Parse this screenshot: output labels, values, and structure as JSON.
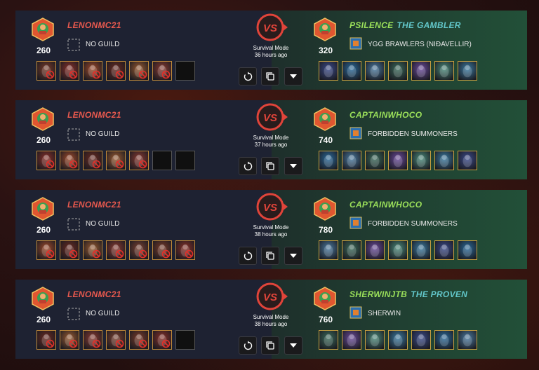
{
  "battles": [
    {
      "vs_label": "VS",
      "mode": "Survival Mode",
      "time": "36 hours ago",
      "left": {
        "name": "LENONMC21",
        "title": "",
        "rating": "260",
        "guild": "NO GUILD",
        "cards": [
          "c1",
          "c2",
          "c3",
          "c4",
          "c5",
          "c6",
          "empty"
        ]
      },
      "right": {
        "name": "PSILENCE",
        "title": "THE GAMBLER",
        "rating": "320",
        "guild": "YGG BRAWLERS (NIÐAVELLIR)",
        "cards": [
          "w1",
          "w2",
          "w3",
          "w4",
          "w5",
          "w6",
          "w7"
        ]
      }
    },
    {
      "vs_label": "VS",
      "mode": "Survival Mode",
      "time": "37 hours ago",
      "left": {
        "name": "LENONMC21",
        "title": "",
        "rating": "260",
        "guild": "NO GUILD",
        "cards": [
          "c1",
          "c2",
          "c3",
          "c4",
          "c5",
          "empty",
          "empty"
        ]
      },
      "right": {
        "name": "CAPTAINWHOCO",
        "title": "",
        "rating": "740",
        "guild": "FORBIDDEN SUMMONERS",
        "cards": [
          "w1",
          "w2",
          "w3",
          "w4",
          "w5",
          "w6",
          "w7"
        ]
      }
    },
    {
      "vs_label": "VS",
      "mode": "Survival Mode",
      "time": "38 hours ago",
      "left": {
        "name": "LENONMC21",
        "title": "",
        "rating": "260",
        "guild": "NO GUILD",
        "cards": [
          "c1",
          "c2",
          "c3",
          "c4",
          "c5",
          "c6",
          "c7"
        ]
      },
      "right": {
        "name": "CAPTAINWHOCO",
        "title": "",
        "rating": "780",
        "guild": "FORBIDDEN SUMMONERS",
        "cards": [
          "w1",
          "w2",
          "w3",
          "w4",
          "w5",
          "w6",
          "w7"
        ]
      }
    },
    {
      "vs_label": "VS",
      "mode": "Survival Mode",
      "time": "38 hours ago",
      "left": {
        "name": "LENONMC21",
        "title": "",
        "rating": "260",
        "guild": "NO GUILD",
        "cards": [
          "c1",
          "c2",
          "c3",
          "c4",
          "c5",
          "c6",
          "empty"
        ]
      },
      "right": {
        "name": "SHERWINJTB",
        "title": "THE PROVEN",
        "rating": "760",
        "guild": "SHERWIN",
        "cards": [
          "w1",
          "w2",
          "w3",
          "w4",
          "w5",
          "w6",
          "w7"
        ]
      }
    }
  ],
  "icons": {
    "avatar": "player-avatar-icon",
    "vs": "versus-badge-icon",
    "rematch": "replay-icon",
    "copy": "copy-icon",
    "expand": "chevron-down-icon",
    "defeated": "card-defeated-icon",
    "no_guild": "no-guild-icon"
  },
  "colors": {
    "loser_name": "#e8594e",
    "winner_name": "#9be05a",
    "title": "#62c6c9",
    "vs_red": "#e0443a",
    "left_panel": "#1e2232",
    "right_panel": "#225038"
  }
}
